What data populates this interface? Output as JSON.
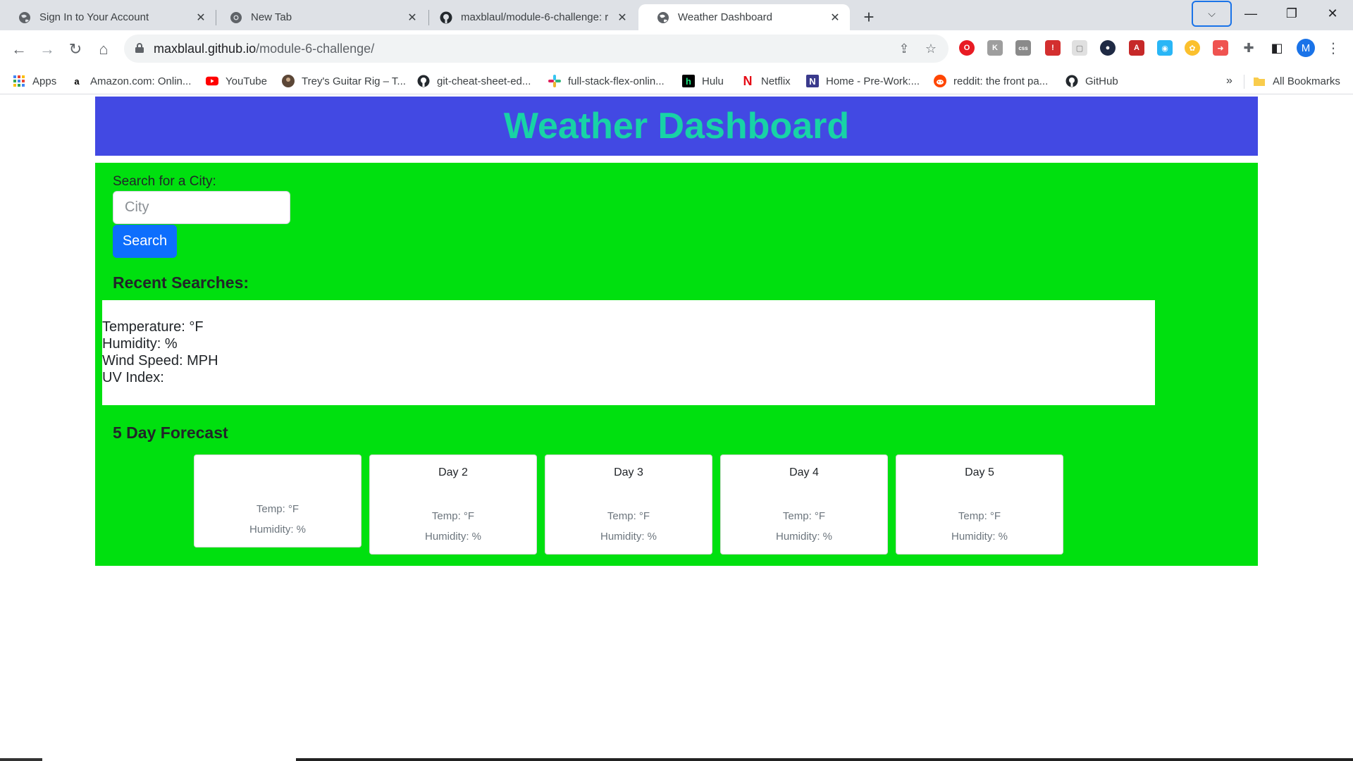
{
  "browser": {
    "tabs": [
      {
        "title": "Sign In to Your Account",
        "active": false,
        "icon": "globe-icon"
      },
      {
        "title": "New Tab",
        "active": false,
        "icon": "chrome-icon"
      },
      {
        "title": "maxblaul/module-6-challenge: r",
        "active": false,
        "icon": "github-icon"
      },
      {
        "title": "Weather Dashboard",
        "active": true,
        "icon": "globe-icon"
      }
    ],
    "url_host": "maxblaul.github.io",
    "url_path": "/module-6-challenge/",
    "profile_initial": "M",
    "bookmarks": [
      {
        "label": "Apps",
        "icon": "apps-grid-icon",
        "color": "#4285f4"
      },
      {
        "label": "Amazon.com: Onlin...",
        "icon": "amazon-icon",
        "color": "#000000"
      },
      {
        "label": "YouTube",
        "icon": "youtube-icon",
        "color": "#ff0000"
      },
      {
        "label": "Trey's Guitar Rig – T...",
        "icon": "avatar-icon",
        "color": "#5b4636"
      },
      {
        "label": "git-cheat-sheet-ed...",
        "icon": "github-icon",
        "color": "#24292e"
      },
      {
        "label": "full-stack-flex-onlin...",
        "icon": "slack-icon",
        "color": "#e01e5a"
      },
      {
        "label": "Hulu",
        "icon": "hulu-icon",
        "color": "#000000"
      },
      {
        "label": "Netflix",
        "icon": "netflix-icon",
        "color": "#e50914"
      },
      {
        "label": "Home - Pre-Work:...",
        "icon": "notion-icon",
        "color": "#3a3a8c"
      },
      {
        "label": "reddit: the front pa...",
        "icon": "reddit-icon",
        "color": "#ff4500"
      },
      {
        "label": "GitHub",
        "icon": "github-icon",
        "color": "#24292e"
      }
    ],
    "all_bookmarks": "All Bookmarks",
    "overflow": "»"
  },
  "app": {
    "title": "Weather Dashboard",
    "colors": {
      "header_bg": "#4249e3",
      "title": "#18d3a6",
      "panel_bg": "#00e00f",
      "button": "#0d6efd"
    },
    "search": {
      "label": "Search for a City:",
      "placeholder": "City",
      "button": "Search"
    },
    "recent_heading": "Recent Searches:",
    "current": {
      "temperature": "Temperature: °F",
      "humidity": "Humidity: %",
      "wind": "Wind Speed: MPH",
      "uv": "UV Index:"
    },
    "forecast_heading": "5 Day Forecast",
    "forecast": [
      {
        "day": "",
        "temp": "Temp: °F",
        "humidity": "Humidity: %"
      },
      {
        "day": "Day 2",
        "temp": "Temp: °F",
        "humidity": "Humidity: %"
      },
      {
        "day": "Day 3",
        "temp": "Temp: °F",
        "humidity": "Humidity: %"
      },
      {
        "day": "Day 4",
        "temp": "Temp: °F",
        "humidity": "Humidity: %"
      },
      {
        "day": "Day 5",
        "temp": "Temp: °F",
        "humidity": "Humidity: %"
      }
    ]
  }
}
